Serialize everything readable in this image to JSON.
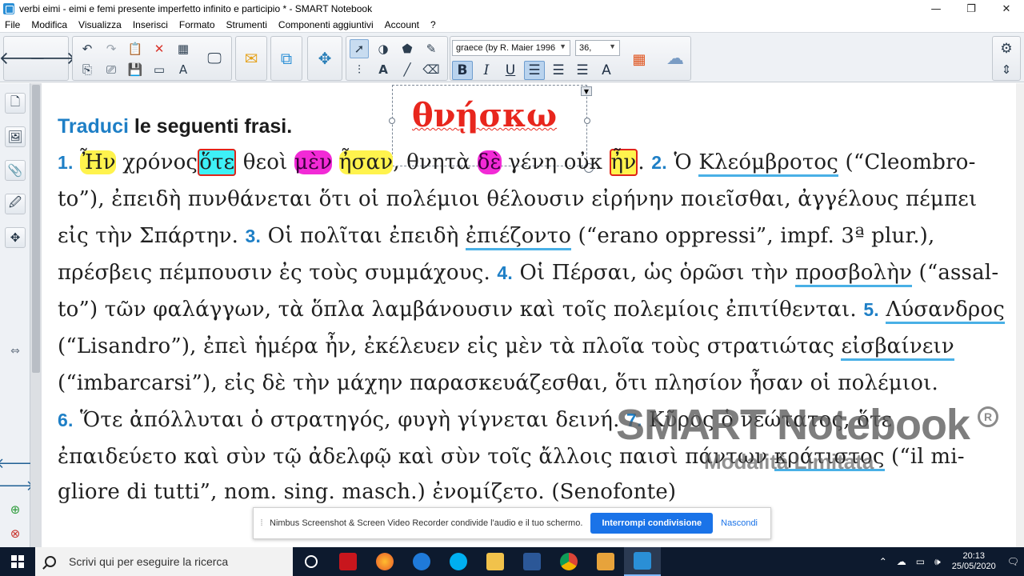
{
  "window": {
    "title": "verbi eimi - eimi e femi presente imperfetto infinito e participio * - SMART Notebook",
    "minimize": "—",
    "maximize": "❐",
    "close": "✕"
  },
  "menu": [
    "File",
    "Modifica",
    "Visualizza",
    "Inserisci",
    "Formato",
    "Strumenti",
    "Componenti aggiuntivi",
    "Account",
    "?"
  ],
  "toolbar": {
    "font_name": "graece (by R. Maier 1996",
    "font_size": "36,",
    "bold": "B",
    "italic": "I",
    "underline": "U"
  },
  "page": {
    "heading_blue": "Traduci",
    "heading_rest": " le seguenti frasi.",
    "textbox_word": "θνῄσκω",
    "lines": {
      "l1": {
        "n1": "1.",
        "a": " ",
        "hn": "Ἦν",
        "b": " χρόνος",
        "ote": "ὅτε",
        "c": " θεοὶ ",
        "men": "μὲν",
        "d": " ",
        "hsan": "ἦσαν",
        "e": ", θνητὰ ",
        "de": "δὲ",
        "f": " γένη οὐκ ",
        "hn2": "ἦν",
        "g": ". ",
        "n2": "2.",
        "h": " Ὁ ",
        "kleo": "Κλεόμβροτος",
        "i": " (“Cleombro-"
      },
      "l2": "to”), ἐπειδὴ πυνθάνεται ὅτι οἱ πολέμιοι θέλουσιν εἰρήνην ποιεῖσθαι, ἀγγέλους πέμπει",
      "l3": {
        "a": "εἰς τὴν Σπάρτην. ",
        "n3": "3.",
        "b": " Οἱ πολῖται ἐπειδὴ ",
        "epie": "ἐπιέζοντο",
        "c": " (“erano oppressi”, impf. 3ª plur.),"
      },
      "l4": {
        "a": "πρέσβεις πέμπουσιν ἐς τοὺς συμμάχους. ",
        "n4": "4.",
        "b": " Οἱ Πέρσαι, ὡς ὁρῶσι τὴν ",
        "pros": "προσβολὴν",
        "c": " (“assal-"
      },
      "l5": {
        "a": "to”) τῶν φαλάγγων, τὰ ὅπλα λαμβάνουσιν καὶ τοῖς πολεμίοις ἐπιτίθενται. ",
        "n5": "5.",
        "b": " ",
        "lys": "Λύσανδρος"
      },
      "l6": {
        "a": "(“Lisandro”), ἐπεὶ ἡμέρα ἦν, ἐκέλευεν εἰς μὲν τὰ πλοῖα τοὺς στρατιώτας ",
        "eis": "εἰσβαίνειν"
      },
      "l7": "(“imbarcarsi”), εἰς δὲ τὴν μάχην παρασκευάζεσθαι, ὅτι πλησίον ἦσαν οἱ πολέμιοι.",
      "l8": {
        "n6": "6.",
        "a": " Ὅτε ἀπόλλυται ὁ στρατηγός, φυγὴ γίγνεται δεινή. ",
        "n7": "7.",
        "b": " Κῦρος ὁ νεώτατος, ὅτε"
      },
      "l9": {
        "a": "ἐπαιδεύετο καὶ σὺν τῷ ἀδελφῷ καὶ σὺν τοῖς ἄλλοις παισὶ πάντων ",
        "krat": "κράτιστος",
        "b": " (“il mi-"
      },
      "l10": "gliore di tutti”, nom. sing. masch.) ἐνομίζετο. (Senofonte)"
    },
    "watermark": "SMART Notebook",
    "watermark_sub": "Modalità Limitata",
    "registered": "R"
  },
  "sharebar": {
    "message": "Nimbus Screenshot & Screen Video Recorder condivide l'audio e il tuo schermo.",
    "stop_label": "Interrompi condivisione",
    "hide_label": "Nascondi"
  },
  "taskbar": {
    "search_placeholder": "Scrivi qui per eseguire la ricerca",
    "time": "20:13",
    "date": "25/05/2020"
  },
  "colors": {
    "highlight_yellow": "#fff34d",
    "highlight_cyan": "#3ef0f6",
    "highlight_magenta": "#f22ad6",
    "ink_red": "#e0251b",
    "accent_blue": "#1e7fc6"
  }
}
